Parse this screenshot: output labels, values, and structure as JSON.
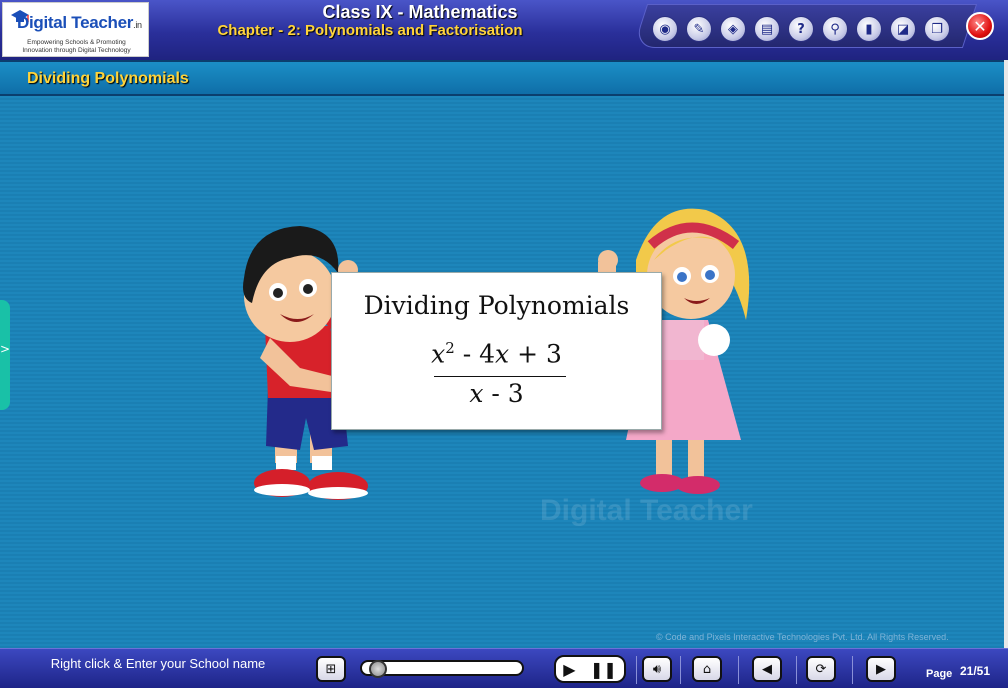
{
  "logo": {
    "name": "Digital Teacher",
    "suffix": ".in",
    "tagline_line1": "Empowering Schools & Promoting",
    "tagline_line2": "Innovation through Digital Technology"
  },
  "header": {
    "title": "Class IX - Mathematics",
    "subtitle": "Chapter - 2: Polynomials and Factorisation",
    "tools": [
      {
        "name": "camera-tool-icon",
        "glyph": "◉"
      },
      {
        "name": "pen-tool-icon",
        "glyph": "✎"
      },
      {
        "name": "eraser-tool-icon",
        "glyph": "◈"
      },
      {
        "name": "notes-tool-icon",
        "glyph": "▤"
      },
      {
        "name": "help-icon",
        "glyph": "?"
      },
      {
        "name": "search-icon",
        "glyph": "⚲"
      },
      {
        "name": "book-icon",
        "glyph": "▮"
      },
      {
        "name": "highlighter-icon",
        "glyph": "◪"
      },
      {
        "name": "window-icon",
        "glyph": "❐"
      }
    ],
    "close_glyph": "✕"
  },
  "section": {
    "title": "Dividing Polynomials"
  },
  "card": {
    "title": "Dividing Polynomials",
    "numerator_var": "x",
    "numerator_exp": "2",
    "numerator_rest_a": " - 4",
    "numerator_var2": "x",
    "numerator_rest_b": " + 3",
    "denominator_var": "x",
    "denominator_rest": " - 3"
  },
  "watermark": "Digital Teacher",
  "copyright": "© Code and Pixels Interactive Technologies  Pvt. Ltd. All Rights Reserved.",
  "bottom": {
    "school_prompt": "Right click & Enter your School name",
    "progress": 0.05,
    "page_label": "Page",
    "page_value": "21/51"
  }
}
